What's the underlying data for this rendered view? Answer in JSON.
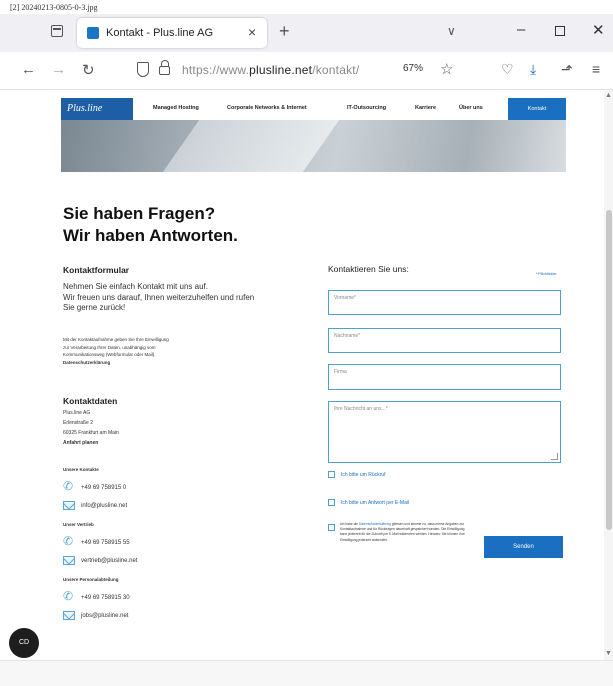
{
  "screenshot_label": "[2] 20240213-0805-0-3.jpg",
  "browser": {
    "tab_title": "Kontakt - Plus.line AG",
    "tab_close": "×",
    "new_tab": "+",
    "tabs_menu": "∨",
    "win_min": "–",
    "win_close": "✕",
    "back": "←",
    "forward": "→",
    "reload": "↻",
    "url_prefix": "https://www.",
    "url_domain": "plusline.net",
    "url_path": "/kontakt/",
    "zoom": "67%",
    "bookmark": "☆",
    "pocket": "♡",
    "download": "⤓",
    "extensions": "⬏",
    "menu": "≡",
    "scroll_up": "▲",
    "scroll_down": "▼"
  },
  "site": {
    "logo": "Plus.line",
    "nav": [
      {
        "label": "Managed Hosting"
      },
      {
        "label": "Corporate Networks & Internet"
      },
      {
        "label": "IT-Outsourcing"
      },
      {
        "label": "Karriere"
      },
      {
        "label": "Über uns"
      }
    ],
    "cta": "Kontakt"
  },
  "content": {
    "headline_1": "Sie haben Fragen?",
    "headline_2": "Wir haben Antworten.",
    "contact_form_title": "Kontaktformular",
    "intro_1": "Nehmen Sie einfach Kontakt mit uns auf.",
    "intro_2": "Wir freuen uns darauf, Ihnen weiterzuhelfen und rufen",
    "intro_3": "Sie gerne zurück!",
    "privacy_1": "Mit der Kontaktaufnahme geben Sie Ihre Einwilligung",
    "privacy_2": "zur Verarbeitung Ihrer Daten, unabhängig vom",
    "privacy_3": "Kommunikationsweg (Webformular oder Mail).",
    "privacy_link": "Datenschutzerklärung",
    "contact_data_title": "Kontaktdaten",
    "company": "Plus.line AG",
    "street": "Erlenstraße 2",
    "city": "60325 Frankfurt am Main",
    "directions": "Anfahrt planen",
    "general_label": "Unsere Kontakte",
    "general_phone": "+49 69 758915 0",
    "general_mail": "info@plusline.net",
    "sales_label": "Unser Vertrieb",
    "sales_phone": "+49 69 758915 55",
    "sales_mail": "vertrieb@plusline.net",
    "hr_label": "Unsere Personalabteilung",
    "hr_phone": "+49 69 758915 30",
    "hr_mail": "jobs@plusline.net"
  },
  "form": {
    "title": "Kontaktieren Sie uns:",
    "required_hint": "* Pflichtfelder",
    "firstname_placeholder": "Vorname*",
    "lastname_placeholder": "Nachname*",
    "company_placeholder": "Firma",
    "message_placeholder": "Ihre Nachricht an uns...*",
    "callback": "Ich bitte um Rückruf",
    "email_reply": "Ich bitte um Antwort per E-Mail",
    "consent_1": "Ich habe die",
    "consent_link": "Datenschutzerklärung",
    "consent_2": "gelesen und stimme zu, dass meine Angaben zur Kontaktaufnahme und für Rückfragen dauerhaft gespeichert werden. Die Einwilligung kann jederzeit für die Zukunft per E-Mail widerrufen werden. Hinweis: Sie können Ihre Einwilligung jederzeit widerrufen.",
    "submit": "Senden"
  },
  "cookie_button": "CD"
}
